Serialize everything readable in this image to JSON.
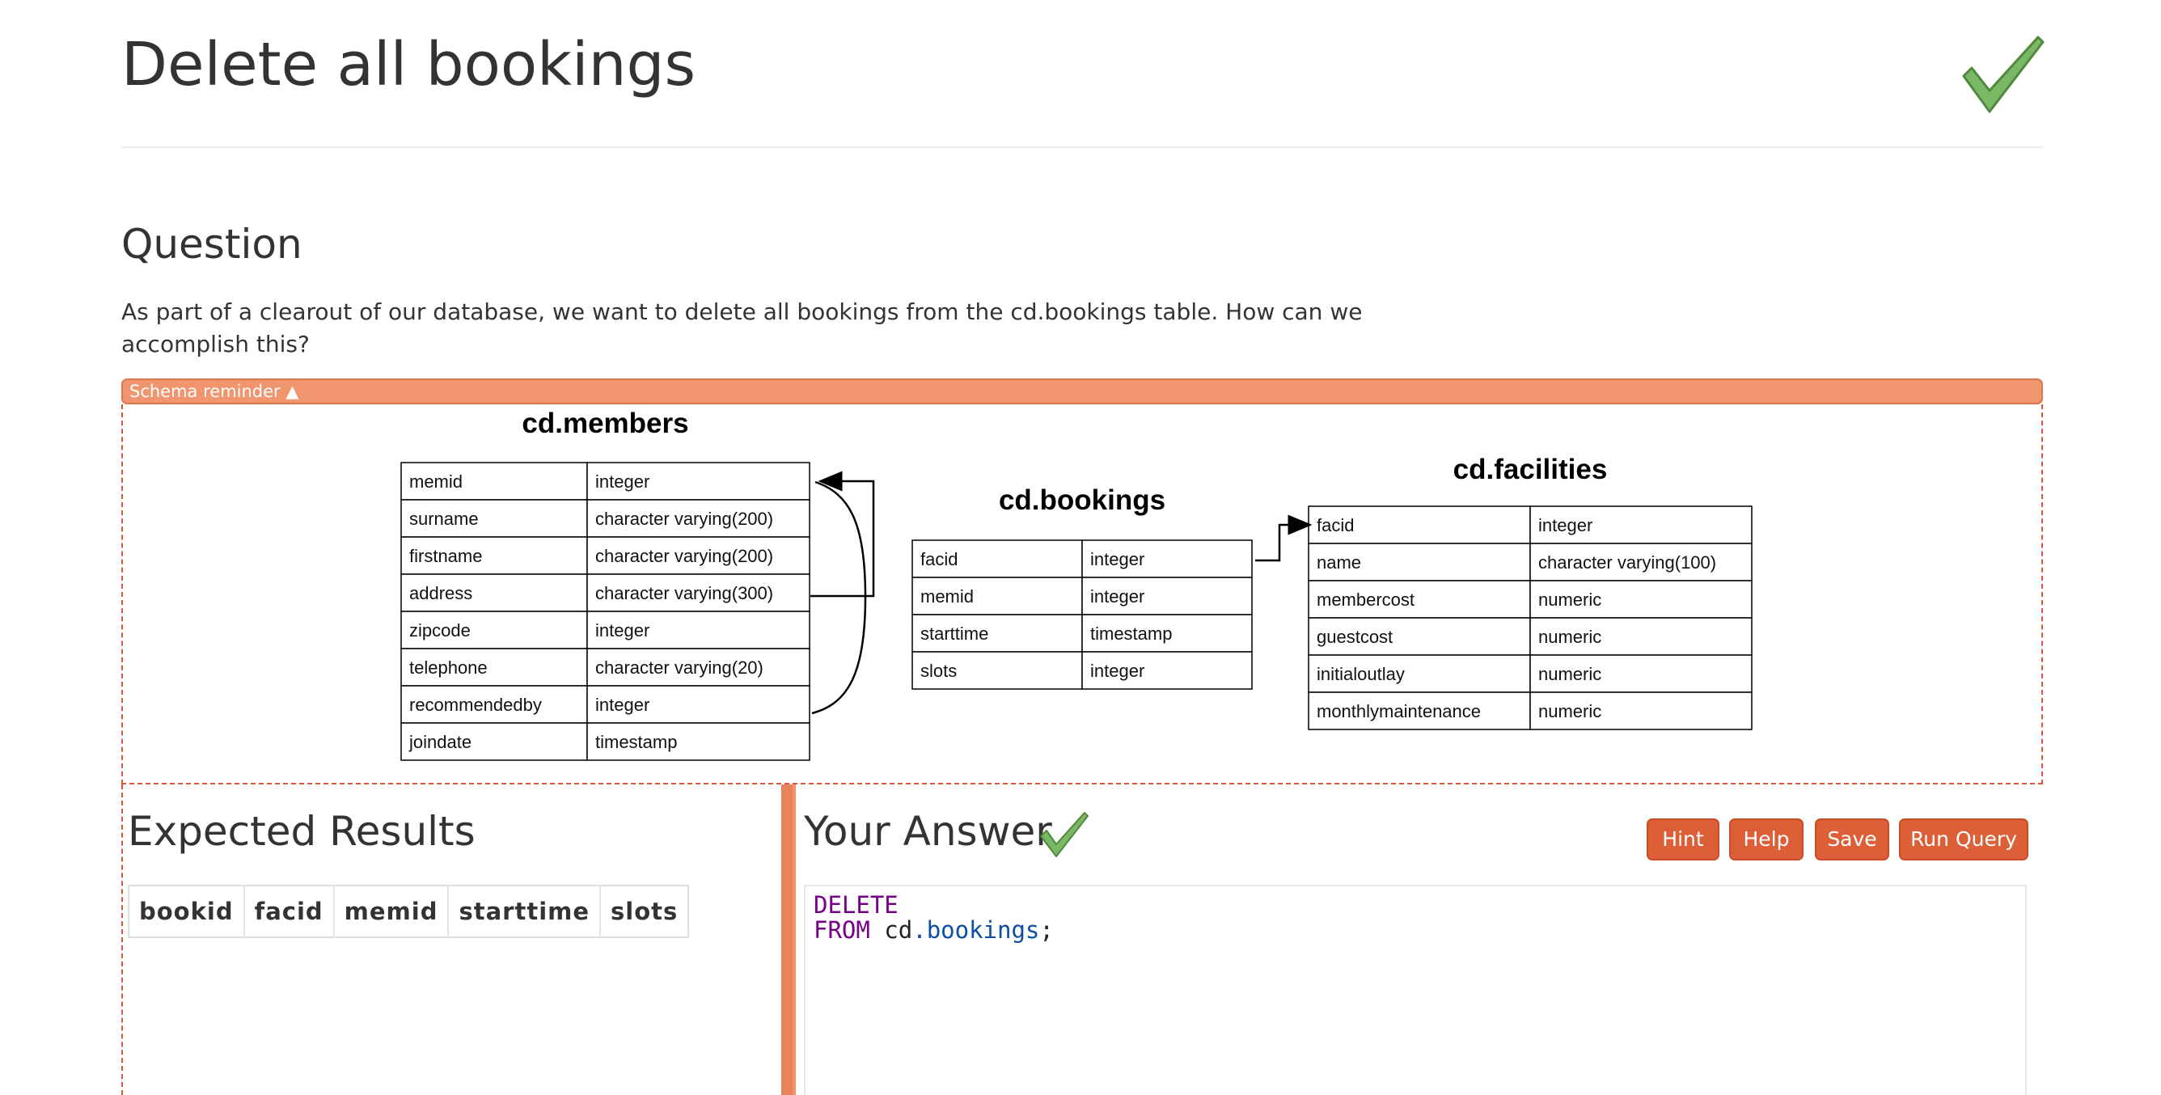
{
  "page": {
    "title": "Delete all bookings"
  },
  "question": {
    "heading": "Question",
    "text": "As part of a clearout of our database, we want to delete all bookings from the cd.bookings table. How can we accomplish this?"
  },
  "schema": {
    "toggle_label": "Schema reminder ▲",
    "tables": [
      {
        "name": "cd.members",
        "rows": [
          [
            "memid",
            "integer"
          ],
          [
            "surname",
            "character varying(200)"
          ],
          [
            "firstname",
            "character varying(200)"
          ],
          [
            "address",
            "character varying(300)"
          ],
          [
            "zipcode",
            "integer"
          ],
          [
            "telephone",
            "character varying(20)"
          ],
          [
            "recommendedby",
            "integer"
          ],
          [
            "joindate",
            "timestamp"
          ]
        ]
      },
      {
        "name": "cd.bookings",
        "rows": [
          [
            "facid",
            "integer"
          ],
          [
            "memid",
            "integer"
          ],
          [
            "starttime",
            "timestamp"
          ],
          [
            "slots",
            "integer"
          ]
        ]
      },
      {
        "name": "cd.facilities",
        "rows": [
          [
            "facid",
            "integer"
          ],
          [
            "name",
            "character varying(100)"
          ],
          [
            "membercost",
            "numeric"
          ],
          [
            "guestcost",
            "numeric"
          ],
          [
            "initialoutlay",
            "numeric"
          ],
          [
            "monthlymaintenance",
            "numeric"
          ]
        ]
      }
    ]
  },
  "expected": {
    "heading": "Expected Results",
    "columns": [
      "bookid",
      "facid",
      "memid",
      "starttime",
      "slots"
    ]
  },
  "answer": {
    "heading": "Your Answer",
    "buttons": {
      "hint": "Hint",
      "help": "Help",
      "save": "Save",
      "run": "Run Query"
    },
    "code": {
      "line1_kw": "DELETE",
      "line2_kw": "FROM",
      "line2_obj": "cd",
      "line2_prop": ".bookings",
      "line2_end": ";"
    }
  },
  "colors": {
    "accent": "#f0956e",
    "button": "#dd5f38",
    "check": "#7bb866",
    "keyword": "#770088",
    "property": "#0b4ea3"
  },
  "icons": {
    "title_status": "checkmark-icon",
    "answer_status": "checkmark-icon"
  }
}
